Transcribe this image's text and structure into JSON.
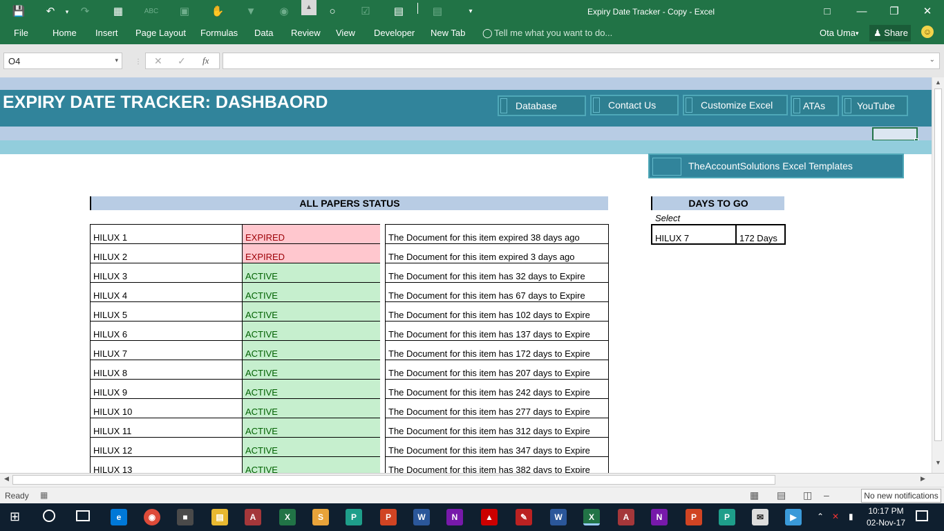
{
  "window": {
    "title": "Expiry Date Tracker - Copy  -  Excel",
    "user": "Ota Uma",
    "share": "Share"
  },
  "ribbon": {
    "tabs": [
      "File",
      "Home",
      "Insert",
      "Page Layout",
      "Formulas",
      "Data",
      "Review",
      "View",
      "Developer",
      "New Tab"
    ],
    "tell_me": "Tell me what you want to do..."
  },
  "formula_bar": {
    "name_box": "O4",
    "fx": "fx",
    "content": ""
  },
  "sheet": {
    "banner_title": "EXPIRY DATE TRACKER: DASHBAORD",
    "nav_buttons": [
      "Database",
      "Contact Us",
      "Customize Excel",
      "ATAs",
      "YouTube"
    ],
    "brand_button": "TheAccountSolutions Excel Templates",
    "status_header": "ALL PAPERS STATUS",
    "days_header": "DAYS TO GO",
    "select_label": "Select",
    "selected_item": "HILUX 7",
    "selected_days": "172 Days",
    "rows": [
      {
        "item": "HILUX 1",
        "status": "EXPIRED",
        "message": "The Document for this item expired 38 days ago"
      },
      {
        "item": "HILUX 2",
        "status": "EXPIRED",
        "message": "The Document for this item expired 3 days ago"
      },
      {
        "item": "HILUX 3",
        "status": "ACTIVE",
        "message": "The Document for this item has 32 days to Expire"
      },
      {
        "item": "HILUX 4",
        "status": "ACTIVE",
        "message": "The Document for this item has 67 days to Expire"
      },
      {
        "item": "HILUX 5",
        "status": "ACTIVE",
        "message": "The Document for this item has 102 days to Expire"
      },
      {
        "item": "HILUX 6",
        "status": "ACTIVE",
        "message": "The Document for this item has 137 days to Expire"
      },
      {
        "item": "HILUX 7",
        "status": "ACTIVE",
        "message": "The Document for this item has 172 days to Expire"
      },
      {
        "item": "HILUX 8",
        "status": "ACTIVE",
        "message": "The Document for this item has 207 days to Expire"
      },
      {
        "item": "HILUX 9",
        "status": "ACTIVE",
        "message": "The Document for this item has 242 days to Expire"
      },
      {
        "item": "HILUX 10",
        "status": "ACTIVE",
        "message": "The Document for this item has 277 days to Expire"
      },
      {
        "item": "HILUX 11",
        "status": "ACTIVE",
        "message": "The Document for this item has 312 days to Expire"
      },
      {
        "item": "HILUX 12",
        "status": "ACTIVE",
        "message": "The Document for this item has 347 days to Expire"
      },
      {
        "item": "HILUX 13",
        "status": "ACTIVE",
        "message": "The Document for this item has 382 days to Expire"
      }
    ]
  },
  "status_bar": {
    "ready": "Ready",
    "notification": "No new notifications"
  },
  "taskbar": {
    "time": "10:17 PM",
    "date": "02-Nov-17"
  },
  "colors": {
    "excel_green": "#217346",
    "banner_teal": "#31849b",
    "header_blue": "#b8cce4",
    "light_teal": "#92cddc",
    "expired_fill": "#ffc7ce",
    "active_fill": "#c6efce"
  }
}
